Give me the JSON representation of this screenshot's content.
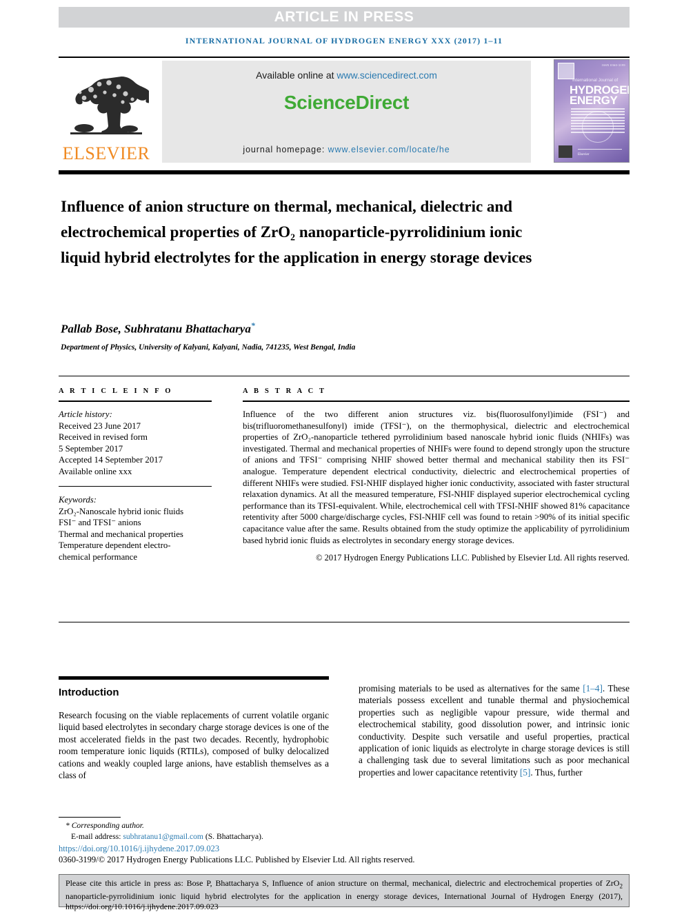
{
  "header": {
    "press_banner": "ARTICLE IN PRESS",
    "running_head": "INTERNATIONAL JOURNAL OF HYDROGEN ENERGY XXX (2017) 1–11"
  },
  "masthead": {
    "publisher_logo_text": "ELSEVIER",
    "available_label": "Available online at ",
    "available_url": "www.sciencedirect.com",
    "sciencedirect_logo": "ScienceDirect",
    "homepage_label": "journal homepage: ",
    "homepage_url": "www.elsevier.com/locate/he",
    "cover": {
      "line_small": "International Journal of",
      "line_big1": "HYDROGEN",
      "line_big2": "ENERGY",
      "corner_code": "ISSN 0360-3199",
      "publisher": "Elsevier"
    }
  },
  "article": {
    "title": "Influence of anion structure on thermal, mechanical, dielectric and electrochemical properties of ZrO₂ nanoparticle-pyrrolidinium ionic liquid hybrid electrolytes for the application in energy storage devices",
    "authors": "Pallab Bose, Subhratanu Bhattacharya",
    "corresponding_marker": "*",
    "affiliation": "Department of Physics, University of Kalyani, Kalyani, Nadia, 741235, West Bengal, India"
  },
  "article_info": {
    "heading": "A R T I C L E  I N F O",
    "history_label": "Article history:",
    "history": [
      "Received 23 June 2017",
      "Received in revised form",
      "5 September 2017",
      "Accepted 14 September 2017",
      "Available online xxx"
    ],
    "keywords_label": "Keywords:",
    "keywords": [
      "ZrO₂-Nanoscale hybrid ionic fluids",
      "FSI⁻ and TFSI⁻ anions",
      "Thermal and mechanical properties",
      "Temperature dependent electro-",
      "chemical performance"
    ]
  },
  "abstract": {
    "heading": "A B S T R A C T",
    "body": "Influence of the two different anion structures viz. bis(fluorosulfonyl)imide (FSI⁻) and bis(trifluoromethanesulfonyl) imide (TFSI⁻), on the thermophysical, dielectric and electrochemical properties of ZrO₂-nanoparticle tethered pyrrolidinium based nanoscale hybrid ionic fluids (NHIFs) was investigated. Thermal and mechanical properties of NHIFs were found to depend strongly upon the structure of anions and TFSI⁻ comprising NHIF showed better thermal and mechanical stability then its FSI⁻ analogue. Temperature dependent electrical conductivity, dielectric and electrochemical properties of different NHIFs were studied. FSI-NHIF displayed higher ionic conductivity, associated with faster structural relaxation dynamics. At all the measured temperature, FSI-NHIF displayed superior electrochemical cycling performance than its TFSI-equivalent. While, electrochemical cell with TFSI-NHIF showed 81% capacitance retentivity after 5000 charge/discharge cycles, FSI-NHIF cell was found to retain >90% of its initial specific capacitance value after the same. Results obtained from the study optimize the applicability of pyrrolidinium based hybrid ionic fluids as electrolytes in secondary energy storage devices.",
    "copyright": "© 2017 Hydrogen Energy Publications LLC. Published by Elsevier Ltd. All rights reserved."
  },
  "introduction": {
    "heading": "Introduction",
    "col_left": "Research focusing on the viable replacements of current volatile organic liquid based electrolytes in secondary charge storage devices is one of the most accelerated fields in the past two decades. Recently, hydrophobic room temperature ionic liquids (RTILs), composed of bulky delocalized cations and weakly coupled large anions, have establish themselves as a class of",
    "col_right_part1": "promising materials to be used as alternatives for the same ",
    "col_right_ref1": "[1–4]",
    "col_right_part2": ". These materials possess excellent and tunable thermal and physiochemical properties such as negligible vapour pressure, wide thermal and electrochemical stability, good dissolution power, and intrinsic ionic conductivity. Despite such versatile and useful properties, practical application of ionic liquids as electrolyte in charge storage devices is still a challenging task due to several limitations such as poor mechanical properties and lower capacitance retentivity ",
    "col_right_ref2": "[5]",
    "col_right_part3": ". Thus, further"
  },
  "footnotes": {
    "corresponding": "* Corresponding author.",
    "email_label": "E-mail address: ",
    "email": "subhratanu1@gmail.com",
    "email_suffix": " (S. Bhattacharya).",
    "doi": "https://doi.org/10.1016/j.ijhydene.2017.09.023",
    "issn": "0360-3199/© 2017 Hydrogen Energy Publications LLC. Published by Elsevier Ltd. All rights reserved."
  },
  "cite_box": {
    "text_part1": "Please cite this article in press as: Bose P, Bhattacharya S, Influence of anion structure on thermal, mechanical, dielectric and electrochemical properties of ZrO",
    "subscript": "2",
    "text_part2": " nanoparticle-pyrrolidinium ionic liquid hybrid electrolytes for the application in energy storage devices, International Journal of Hydrogen Energy (2017), https://doi.org/10.1016/j.ijhydene.2017.09.023"
  },
  "colors": {
    "link": "#2a7ab0",
    "elsevier_orange": "#f08a22",
    "sciencedirect_green": "#3faa35",
    "band_gray": "#d2d3d5",
    "banner_gray": "#e7e7e7"
  }
}
